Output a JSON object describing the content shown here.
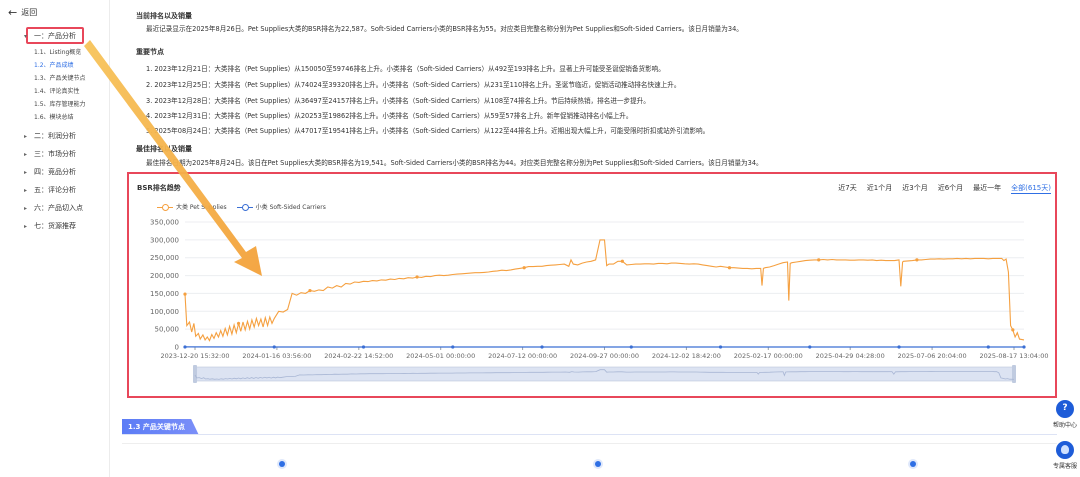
{
  "sidebar": {
    "back_label": "返回",
    "items": [
      {
        "label": "一：产品分析",
        "expanded": true
      },
      {
        "label": "二：利润分析"
      },
      {
        "label": "三：市场分析"
      },
      {
        "label": "四：竞品分析"
      },
      {
        "label": "五：评论分析"
      },
      {
        "label": "六：产品切入点"
      },
      {
        "label": "七：货源推荐"
      }
    ],
    "subitems": [
      "1.1、Listing概览",
      "1.2、产品成绩",
      "1.3、产品关键节点",
      "1.4、评论真实性",
      "1.5、库存管理能力",
      "1.6、模块总结"
    ],
    "active_sub": "1.2、产品成绩"
  },
  "main": {
    "current_title": "当前排名以及销量",
    "current_text": "最近记录显示在2025年8月26日。Pet Supplies大类的BSR排名为22,587。Soft-Sided Carriers小类的BSR排名为55。对应类目完整名称分别为Pet Supplies和Soft-Sided Carriers。该日月销量为34。",
    "events_title": "重要节点",
    "events": [
      "1. 2023年12月21日：大类排名（Pet Supplies）从150050至59746排名上升。小类排名（Soft-Sided Carriers）从492至193排名上升。显著上升可能受圣诞促销备货影响。",
      "2. 2023年12月25日：大类排名（Pet Supplies）从74024至39320排名上升。小类排名（Soft-Sided Carriers）从231至110排名上升。圣诞节临近，促销活动推动排名快速上升。",
      "3. 2023年12月28日：大类排名（Pet Supplies）从36497至24157排名上升。小类排名（Soft-Sided Carriers）从108至74排名上升。节后持续热销，排名进一步提升。",
      "4. 2023年12月31日：大类排名（Pet Supplies）从20253至19862排名上升。小类排名（Soft-Sided Carriers）从59至57排名上升。新年促销推动排名小幅上升。",
      "5. 2025年08月24日：大类排名（Pet Supplies）从47017至19541排名上升。小类排名（Soft-Sided Carriers）从122至44排名上升。近期出现大幅上升，可能受限时折扣或站外引流影响。"
    ],
    "best_title": "最佳排名以及销量",
    "best_text": "最佳排名日期为2025年8月24日。该日在Pet Supplies大类的BSR排名为19,541。Soft-Sided Carriers小类的BSR排名为44。对应类目完整名称分别为Pet Supplies和Soft-Sided Carriers。该日月销量为34。",
    "next_section": "1.3 产品关键节点"
  },
  "chart_panel": {
    "title": "BSR排名趋势",
    "ranges": [
      "近7天",
      "近1个月",
      "近3个月",
      "近6个月",
      "最近一年",
      "全部(615天)"
    ],
    "active_range": "全部(615天)"
  },
  "chart_data": {
    "type": "line",
    "title": "",
    "xlabel": "",
    "ylabel": "",
    "ylim": [
      0,
      350000
    ],
    "yticks": [
      0,
      50000,
      100000,
      150000,
      200000,
      250000,
      300000,
      350000
    ],
    "xtick_labels": [
      "2023-12-20 15:32:00",
      "2024-01-16 03:56:00",
      "2024-02-22 14:52:00",
      "2024-05-01 00:00:00",
      "2024-07-12 00:00:00",
      "2024-09-27 00:00:00",
      "2024-12-02 18:42:00",
      "2025-02-17 00:00:00",
      "2025-04-29 04:28:00",
      "2025-07-06 20:04:00",
      "2025-08-17 13:04:00"
    ],
    "grid": true,
    "legend": "top-left",
    "series": [
      {
        "name": "大类 Pet Supplies",
        "color": "#f5a040",
        "points": [
          [
            0,
            148000
          ],
          [
            0.4,
            60000
          ],
          [
            1,
            70000
          ],
          [
            1.5,
            42000
          ],
          [
            2,
            66000
          ],
          [
            2.4,
            30000
          ],
          [
            3,
            38000
          ],
          [
            3.4,
            22000
          ],
          [
            4,
            34000
          ],
          [
            4.5,
            20000
          ],
          [
            5,
            28000
          ],
          [
            5.5,
            18000
          ],
          [
            6,
            35000
          ],
          [
            6.5,
            24000
          ],
          [
            7,
            40000
          ],
          [
            7.5,
            28000
          ],
          [
            8,
            46000
          ],
          [
            8.5,
            30000
          ],
          [
            9,
            52000
          ],
          [
            9.5,
            34000
          ],
          [
            10,
            58000
          ],
          [
            10.5,
            36000
          ],
          [
            11,
            62000
          ],
          [
            11.5,
            40000
          ],
          [
            12,
            66000
          ],
          [
            12.5,
            44000
          ],
          [
            13,
            70000
          ],
          [
            13.5,
            48000
          ],
          [
            14,
            72000
          ],
          [
            14.5,
            50000
          ],
          [
            15,
            76000
          ],
          [
            15.5,
            56000
          ],
          [
            16,
            80000
          ],
          [
            16.5,
            60000
          ],
          [
            17,
            78000
          ],
          [
            17.5,
            56000
          ],
          [
            18,
            82000
          ],
          [
            18.5,
            60000
          ],
          [
            19,
            84000
          ],
          [
            19.5,
            66000
          ],
          [
            20,
            80000
          ],
          [
            21,
            100000
          ],
          [
            22,
            98000
          ],
          [
            23,
            105000
          ],
          [
            24,
            150000
          ],
          [
            25,
            145000
          ],
          [
            26,
            152000
          ],
          [
            27,
            150000
          ],
          [
            28,
            158000
          ],
          [
            29,
            156000
          ],
          [
            30,
            160000
          ],
          [
            31,
            158000
          ],
          [
            32,
            168000
          ],
          [
            33,
            165000
          ],
          [
            34,
            172000
          ],
          [
            35,
            168000
          ],
          [
            36,
            178000
          ],
          [
            37,
            176000
          ],
          [
            38,
            182000
          ],
          [
            39,
            181000
          ],
          [
            40,
            184000
          ],
          [
            41,
            183000
          ],
          [
            42,
            186000
          ],
          [
            43,
            185000
          ],
          [
            44,
            188000
          ],
          [
            45,
            187000
          ],
          [
            46,
            190000
          ],
          [
            47,
            189000
          ],
          [
            48,
            192000
          ],
          [
            49,
            191000
          ],
          [
            50,
            194000
          ],
          [
            51,
            193000
          ],
          [
            52,
            196000
          ],
          [
            53,
            195000
          ],
          [
            54,
            198000
          ],
          [
            55,
            197000
          ],
          [
            56,
            200000
          ],
          [
            57,
            201000
          ],
          [
            58,
            200000
          ],
          [
            59,
            201000
          ],
          [
            60,
            203000
          ],
          [
            61,
            204000
          ],
          [
            62,
            205000
          ],
          [
            63,
            206000
          ],
          [
            64,
            207000
          ],
          [
            65,
            208000
          ],
          [
            66,
            208000
          ],
          [
            67,
            209000
          ],
          [
            68,
            210000
          ],
          [
            69,
            212000
          ],
          [
            70,
            213000
          ],
          [
            71,
            215000
          ],
          [
            72,
            214000
          ],
          [
            73,
            216000
          ],
          [
            74,
            218000
          ],
          [
            75,
            220000
          ],
          [
            76,
            222000
          ],
          [
            77,
            225000
          ],
          [
            78,
            225000
          ],
          [
            79,
            226000
          ],
          [
            80,
            226000
          ],
          [
            81,
            228000
          ],
          [
            82,
            229000
          ],
          [
            83,
            230000
          ],
          [
            84,
            231000
          ],
          [
            85,
            232000
          ],
          [
            86,
            226000
          ],
          [
            86.5,
            244000
          ],
          [
            87,
            232000
          ],
          [
            88,
            230000
          ],
          [
            89,
            235000
          ],
          [
            90,
            238000
          ],
          [
            91,
            240000
          ],
          [
            92,
            244000
          ],
          [
            93,
            300000
          ],
          [
            94,
            300000
          ],
          [
            94.5,
            228000
          ],
          [
            95,
            232000
          ],
          [
            96,
            232000
          ],
          [
            97,
            240000
          ],
          [
            98,
            240000
          ],
          [
            99,
            230000
          ],
          [
            100,
            231000
          ],
          [
            101,
            232000
          ],
          [
            102,
            232000
          ],
          [
            103,
            233000
          ],
          [
            104,
            233000
          ],
          [
            105,
            232000
          ],
          [
            106,
            234000
          ],
          [
            107,
            234000
          ],
          [
            108,
            233000
          ],
          [
            109,
            235000
          ],
          [
            110,
            235000
          ],
          [
            111,
            234000
          ],
          [
            112,
            233000
          ],
          [
            113,
            232000
          ],
          [
            114,
            233000
          ],
          [
            115,
            232000
          ],
          [
            116,
            230000
          ],
          [
            117,
            228000
          ],
          [
            118,
            226000
          ],
          [
            119,
            224000
          ],
          [
            120,
            226000
          ],
          [
            121,
            224000
          ],
          [
            122,
            222000
          ],
          [
            123,
            222000
          ],
          [
            124,
            221000
          ],
          [
            125,
            220000
          ],
          [
            126,
            220000
          ],
          [
            127,
            219000
          ],
          [
            128,
            220000
          ],
          [
            129,
            220000
          ],
          [
            129.3,
            172000
          ],
          [
            129.6,
            220000
          ],
          [
            130,
            222000
          ],
          [
            131,
            224000
          ],
          [
            132,
            228000
          ],
          [
            133,
            232000
          ],
          [
            134,
            236000
          ],
          [
            135,
            238000
          ],
          [
            135.3,
            130000
          ],
          [
            135.6,
            234000
          ],
          [
            136,
            236000
          ],
          [
            137,
            238000
          ],
          [
            138,
            240000
          ],
          [
            139,
            242000
          ],
          [
            140,
            243000
          ],
          [
            141,
            244000
          ],
          [
            142,
            244000
          ],
          [
            143,
            245000
          ],
          [
            144,
            244000
          ],
          [
            145,
            245000
          ],
          [
            146,
            244000
          ],
          [
            147,
            244000
          ],
          [
            148,
            244000
          ],
          [
            149,
            243000
          ],
          [
            150,
            243000
          ],
          [
            151,
            244000
          ],
          [
            152,
            244000
          ],
          [
            153,
            243000
          ],
          [
            154,
            244000
          ],
          [
            155,
            242000
          ],
          [
            156,
            243000
          ],
          [
            157,
            242000
          ],
          [
            158,
            242000
          ],
          [
            159,
            242000
          ],
          [
            160,
            244000
          ],
          [
            160.4,
            170000
          ],
          [
            160.8,
            238000
          ],
          [
            161,
            240000
          ],
          [
            162,
            241000
          ],
          [
            163,
            242000
          ],
          [
            164,
            244000
          ],
          [
            165,
            244000
          ],
          [
            166,
            245000
          ],
          [
            167,
            246000
          ],
          [
            168,
            246000
          ],
          [
            169,
            247000
          ],
          [
            170,
            246000
          ],
          [
            171,
            247000
          ],
          [
            172,
            247000
          ],
          [
            173,
            248000
          ],
          [
            174,
            247000
          ],
          [
            175,
            248000
          ],
          [
            176,
            247000
          ],
          [
            177,
            248000
          ],
          [
            178,
            248000
          ],
          [
            179,
            248000
          ],
          [
            180,
            247000
          ],
          [
            181,
            248000
          ],
          [
            182,
            248000
          ],
          [
            183,
            248000
          ],
          [
            183.5,
            242000
          ],
          [
            184,
            246000
          ],
          [
            184.5,
            210000
          ],
          [
            185,
            60000
          ],
          [
            185.5,
            48000
          ],
          [
            186,
            28000
          ],
          [
            186.5,
            40000
          ],
          [
            187,
            22000
          ],
          [
            188,
            20000
          ]
        ]
      },
      {
        "name": "小类 Soft-Sided Carriers",
        "color": "#3b6fd4",
        "points": [
          [
            0,
            150
          ],
          [
            20,
            120
          ],
          [
            40,
            100
          ],
          [
            60,
            90
          ],
          [
            80,
            80
          ],
          [
            100,
            75
          ],
          [
            120,
            70
          ],
          [
            140,
            65
          ],
          [
            160,
            60
          ],
          [
            180,
            55
          ],
          [
            188,
            44
          ]
        ]
      }
    ]
  },
  "floating": {
    "help_label": "帮助中心",
    "agent_label": "专属客服"
  }
}
